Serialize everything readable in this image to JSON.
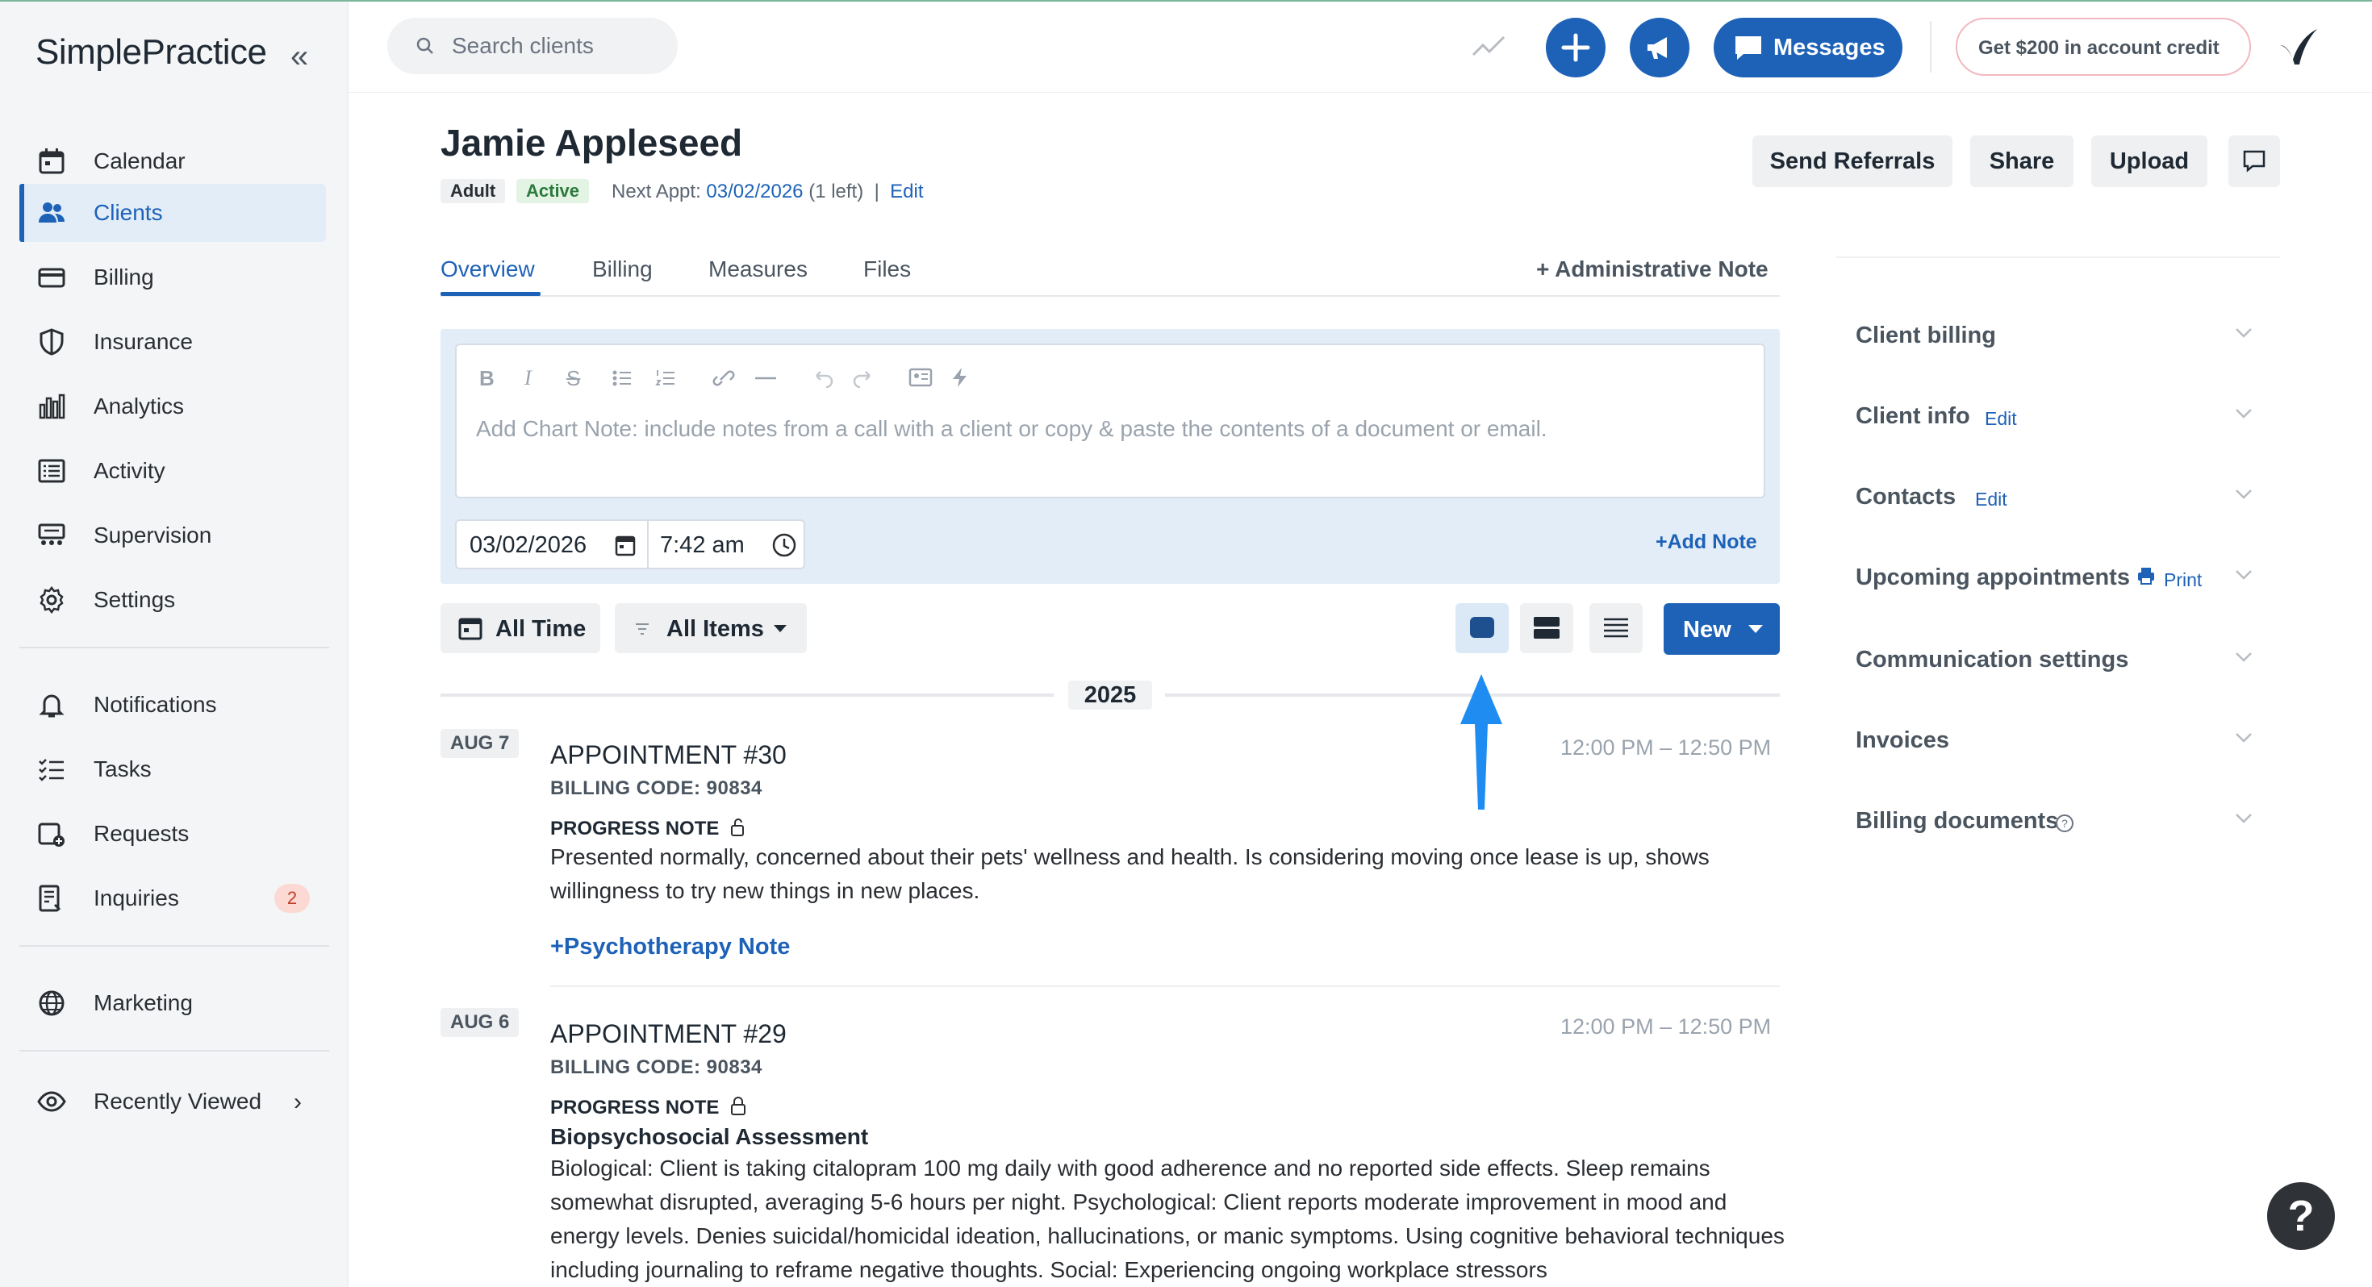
{
  "app": {
    "logo": "SimplePractice"
  },
  "sidebar": {
    "collapse_glyph": "«",
    "items": [
      {
        "label": "Calendar",
        "icon": "calendar-icon",
        "active": false
      },
      {
        "label": "Clients",
        "icon": "clients-icon",
        "active": true
      },
      {
        "label": "Billing",
        "icon": "billing-icon",
        "active": false
      },
      {
        "label": "Insurance",
        "icon": "shield-icon",
        "active": false
      },
      {
        "label": "Analytics",
        "icon": "bar-chart-icon",
        "active": false
      },
      {
        "label": "Activity",
        "icon": "activity-icon",
        "active": false
      },
      {
        "label": "Supervision",
        "icon": "supervision-icon",
        "active": false
      },
      {
        "label": "Settings",
        "icon": "gear-icon",
        "active": false
      }
    ],
    "items2": [
      {
        "label": "Notifications",
        "icon": "bell-icon"
      },
      {
        "label": "Tasks",
        "icon": "tasks-icon"
      },
      {
        "label": "Requests",
        "icon": "requests-icon"
      },
      {
        "label": "Inquiries",
        "icon": "inquiries-icon",
        "badge": "2"
      }
    ],
    "marketing": "Marketing",
    "recently_viewed": "Recently Viewed"
  },
  "topbar": {
    "search_placeholder": "Search clients",
    "messages_label": "Messages",
    "credit_label": "Get $200 in account credit"
  },
  "client": {
    "name": "Jamie Appleseed",
    "tags": [
      "Adult",
      "Active"
    ],
    "next_appt_label": "Next Appt:",
    "next_appt_date": "03/02/2026",
    "next_appt_left": "(1 left)",
    "sep": "|",
    "edit": "Edit"
  },
  "header_buttons": {
    "send_referrals": "Send Referrals",
    "share": "Share",
    "upload": "Upload"
  },
  "tabs": [
    "Overview",
    "Billing",
    "Measures",
    "Files"
  ],
  "admin_note": "+ Administrative Note",
  "composer": {
    "placeholder": "Add Chart Note: include notes from a call with a client or copy & paste the contents of a document or email.",
    "date": "03/02/2026",
    "time": "7:42 am",
    "add_note": "+Add Note",
    "toolbar": [
      "B",
      "I",
      "S"
    ]
  },
  "filters": {
    "time": "All Time",
    "items": "All Items",
    "new": "New"
  },
  "year": "2025",
  "feed": [
    {
      "date": "AUG 7",
      "title": "APPOINTMENT #30",
      "billing_code": "BILLING CODE: 90834",
      "time": "12:00 PM – 12:50 PM",
      "note_type": "PROGRESS NOTE",
      "subtitle": "",
      "text": "Presented normally, concerned about their pets' wellness and health. Is considering moving once lease is up, shows willingness to try new things in new places.",
      "action": "+Psychotherapy Note"
    },
    {
      "date": "AUG 6",
      "title": "APPOINTMENT #29",
      "billing_code": "BILLING CODE: 90834",
      "time": "12:00 PM – 12:50 PM",
      "note_type": "PROGRESS NOTE",
      "subtitle": "Biopsychosocial Assessment",
      "text": "Biological: Client is taking citalopram 100 mg daily with good adherence and no reported side effects. Sleep remains somewhat disrupted, averaging 5-6 hours per night. Psychological: Client reports moderate improvement in mood and energy levels. Denies suicidal/homicidal ideation, hallucinations, or manic symptoms. Using cognitive behavioral techniques including journaling to reframe negative thoughts. Social: Experiencing ongoing workplace stressors"
    }
  ],
  "right_panel": [
    {
      "label": "Client billing"
    },
    {
      "label": "Client info",
      "extra": "Edit"
    },
    {
      "label": "Contacts",
      "extra": "Edit"
    },
    {
      "label": "Upcoming appointments",
      "extra": "Print"
    },
    {
      "label": "Communication settings"
    },
    {
      "label": "Invoices"
    },
    {
      "label": "Billing documents"
    }
  ],
  "help_glyph": "?",
  "colors": {
    "accent": "#1e62b7",
    "sidebar_bg": "#f4f5f7",
    "active_bg": "#e2edf8"
  }
}
